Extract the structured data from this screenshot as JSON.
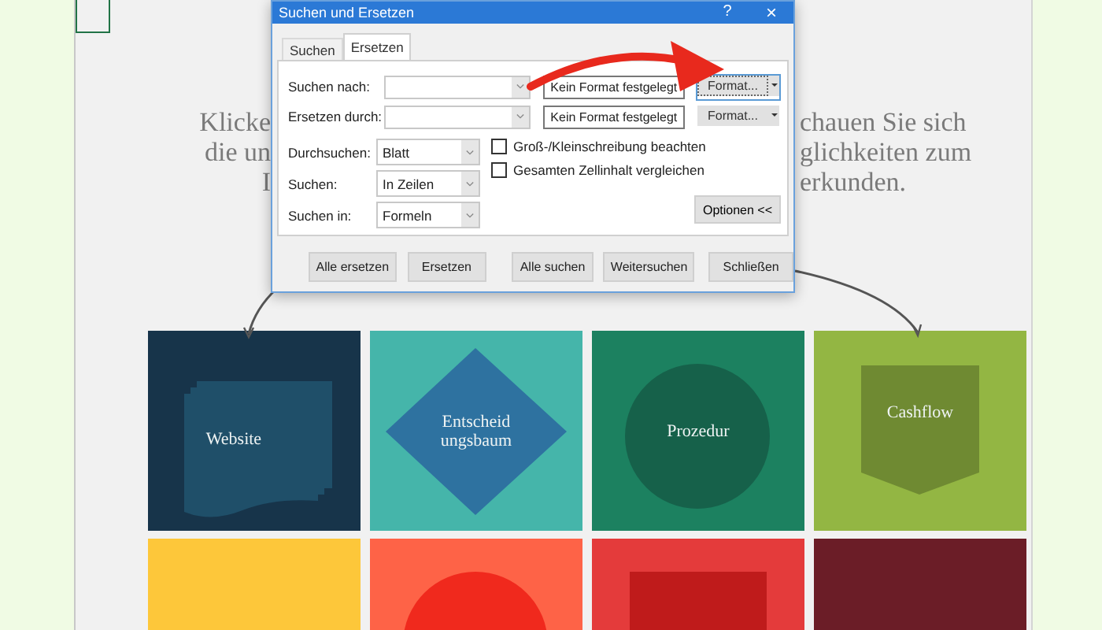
{
  "intro_text": {
    "left_fragments": [
      "Klicke",
      "die un",
      "I"
    ],
    "right_fragments": [
      "chauen Sie sich",
      "glichkeiten zum",
      "erkunden."
    ]
  },
  "tiles": [
    {
      "label": "Website",
      "color": "#17344a",
      "shape": {
        "kind": "document",
        "color": "#1f4f69"
      }
    },
    {
      "label": "Entscheid ungsbaum",
      "color": "#45b5aa",
      "shape": {
        "kind": "diamond",
        "color": "#2e72a0"
      }
    },
    {
      "label": "Prozedur",
      "color": "#1c8160",
      "shape": {
        "kind": "circle",
        "color": "#16614a"
      }
    },
    {
      "label": "Cashflow",
      "color": "#93b643",
      "shape": {
        "kind": "pentagon",
        "color": "#6f8a32"
      }
    },
    {
      "color": "#fdc73a"
    },
    {
      "color": "#fe6347",
      "shape": {
        "kind": "circle",
        "color": "#f0291d"
      }
    },
    {
      "color": "#e43b3b",
      "shape": {
        "kind": "rect",
        "color": "#bf1b1b"
      }
    },
    {
      "color": "#6b1d27"
    }
  ],
  "dialog": {
    "title": "Suchen und Ersetzen",
    "help": "?",
    "close": "×",
    "tabs": [
      {
        "label": "Suchen",
        "selected": false
      },
      {
        "label": "Ersetzen",
        "selected": true
      }
    ],
    "fields": [
      {
        "label": "Suchen nach:",
        "format_status": "Kein Format festgelegt",
        "format_button": "Format...",
        "focused": true
      },
      {
        "label": "Ersetzen durch:",
        "format_status": "Kein Format festgelegt",
        "format_button": "Format...",
        "focused": false
      }
    ],
    "options": [
      {
        "label": "Durchsuchen:",
        "value": "Blatt"
      },
      {
        "label": "Suchen:",
        "value": "In Zeilen"
      },
      {
        "label": "Suchen in:",
        "value": "Formeln"
      }
    ],
    "checkboxes": [
      {
        "label": "Groß-/Kleinschreibung beachten",
        "checked": false
      },
      {
        "label": "Gesamten Zellinhalt vergleichen",
        "checked": false
      }
    ],
    "options_button": "Optionen <<",
    "buttons": [
      "Alle ersetzen",
      "Ersetzen",
      "Alle suchen",
      "Weitersuchen",
      "Schließen"
    ]
  }
}
